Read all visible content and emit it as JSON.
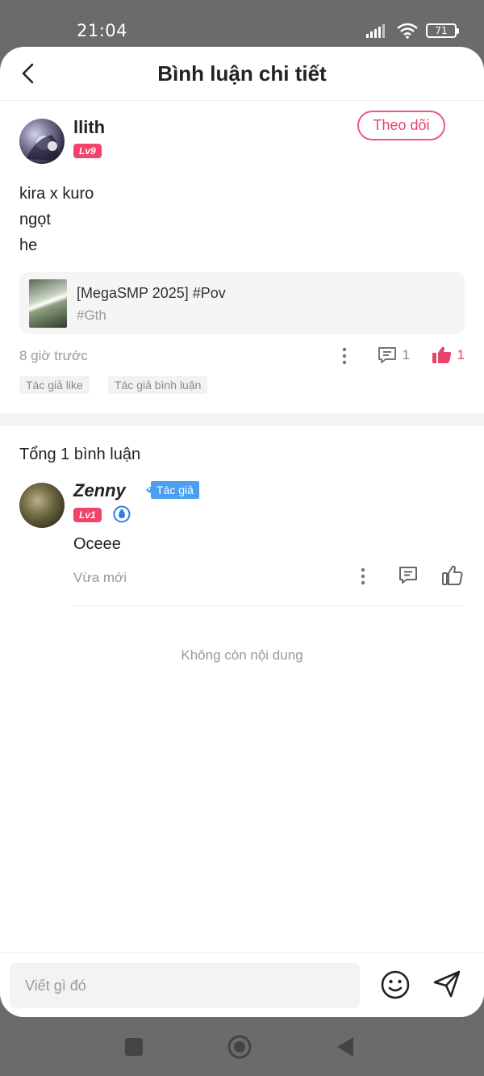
{
  "status_bar": {
    "time": "21:04",
    "battery": "71",
    "icons": [
      "signal-icon",
      "wifi-icon",
      "battery-icon"
    ]
  },
  "header": {
    "title": "Bình luận chi tiết",
    "back_icon": "chevron-left-icon"
  },
  "post": {
    "author": {
      "name": "llith",
      "level": "Lv9"
    },
    "follow_label": "Theo dõi",
    "content_lines": [
      "kira x kuro",
      "ngọt",
      "he"
    ],
    "link_card": {
      "title": "[MegaSMP 2025] #Pov",
      "tag": "#Gth"
    },
    "time": "8 giờ trước",
    "comment_count": "1",
    "like_count": "1",
    "tags": [
      "Tác giả like",
      "Tác giả bình luận"
    ]
  },
  "comments_section": {
    "total_label": "Tổng 1 bình luận",
    "comments": [
      {
        "name": "Zenny",
        "author_tag": "Tác giả",
        "level": "Lv1",
        "text": "Oceee",
        "time": "Vừa mới"
      }
    ],
    "end_text": "Không còn nội dung"
  },
  "input_bar": {
    "placeholder": "Viết gì đó"
  },
  "colors": {
    "accent": "#e8436b",
    "author_tag": "#4a9ff0",
    "muted": "#999999"
  }
}
